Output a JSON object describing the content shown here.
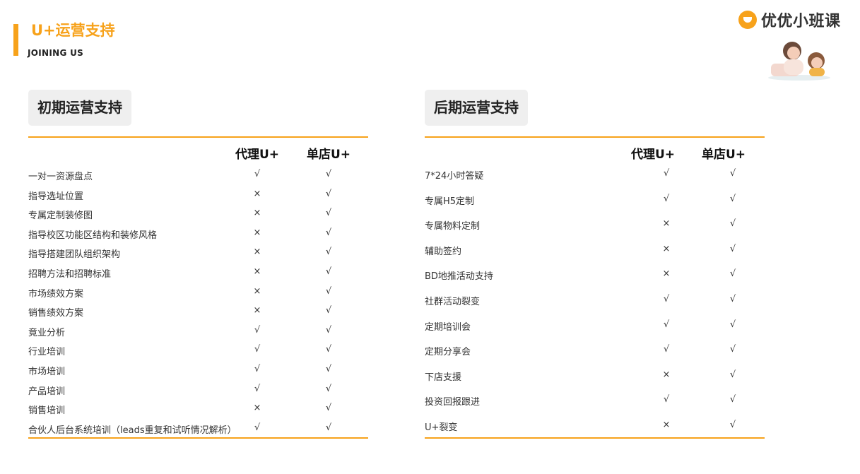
{
  "header": {
    "title": "U+运营支持",
    "subtitle": "JOINING US",
    "brand_name": "优优小班课",
    "brand_color": "#F7A21B"
  },
  "left_section": {
    "title": "初期运营支持",
    "columns": [
      "代理U+",
      "单店U+"
    ],
    "rows": [
      {
        "label": "一对一资源盘点",
        "agent": "√",
        "store": "√"
      },
      {
        "label": "指导选址位置",
        "agent": "×",
        "store": "√"
      },
      {
        "label": "专属定制装修图",
        "agent": "×",
        "store": "√"
      },
      {
        "label": "指导校区功能区结构和装修风格",
        "agent": "×",
        "store": "√"
      },
      {
        "label": "指导搭建团队组织架构",
        "agent": "×",
        "store": "√"
      },
      {
        "label": "招聘方法和招聘标准",
        "agent": "×",
        "store": "√"
      },
      {
        "label": "市场绩效方案",
        "agent": "×",
        "store": "√"
      },
      {
        "label": "销售绩效方案",
        "agent": "×",
        "store": "√"
      },
      {
        "label": "竟业分析",
        "agent": "√",
        "store": "√"
      },
      {
        "label": "行业培训",
        "agent": "√",
        "store": "√"
      },
      {
        "label": "市场培训",
        "agent": "√",
        "store": "√"
      },
      {
        "label": "产品培训",
        "agent": "√",
        "store": "√"
      },
      {
        "label": "销售培训",
        "agent": "×",
        "store": "√"
      },
      {
        "label": "合伙人后台系统培训（leads重复和试听情况解析）",
        "agent": "√",
        "store": "√"
      }
    ]
  },
  "right_section": {
    "title": "后期运营支持",
    "columns": [
      "代理U+",
      "单店U+"
    ],
    "rows": [
      {
        "label": "7*24小时答疑",
        "agent": "√",
        "store": "√"
      },
      {
        "label": "专属H5定制",
        "agent": "√",
        "store": "√"
      },
      {
        "label": "专属物料定制",
        "agent": "×",
        "store": "√"
      },
      {
        "label": "辅助签约",
        "agent": "×",
        "store": "√"
      },
      {
        "label": "BD地推活动支持",
        "agent": "×",
        "store": "√"
      },
      {
        "label": "社群活动裂变",
        "agent": "√",
        "store": "√"
      },
      {
        "label": "定期培训会",
        "agent": "√",
        "store": "√"
      },
      {
        "label": "定期分享会",
        "agent": "√",
        "store": "√"
      },
      {
        "label": "下店支援",
        "agent": "×",
        "store": "√"
      },
      {
        "label": "投资回报跟进",
        "agent": "√",
        "store": "√"
      },
      {
        "label": "U+裂变",
        "agent": "×",
        "store": "√"
      }
    ]
  }
}
